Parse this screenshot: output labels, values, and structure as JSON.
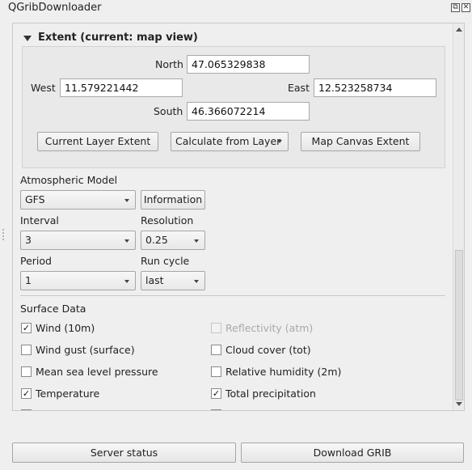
{
  "window": {
    "title": "QGribDownloader",
    "float_glyph": "⧉",
    "close_glyph": "✕"
  },
  "extent": {
    "title": "Extent (current: map view)",
    "north_label": "North",
    "north_value": "47.065329838",
    "west_label": "West",
    "west_value": "11.579221442",
    "east_label": "East",
    "east_value": "12.523258734",
    "south_label": "South",
    "south_value": "46.366072214",
    "current_layer_button": "Current Layer Extent",
    "calc_from_layer_button": "Calculate from Layer",
    "map_canvas_button": "Map Canvas Extent"
  },
  "model": {
    "label": "Atmospheric Model",
    "value": "GFS",
    "information_button": "Information"
  },
  "interval": {
    "label": "Interval",
    "value": "3"
  },
  "resolution": {
    "label": "Resolution",
    "value": "0.25"
  },
  "period": {
    "label": "Period",
    "value": "1"
  },
  "run_cycle": {
    "label": "Run cycle",
    "value": "last"
  },
  "surface": {
    "title": "Surface Data",
    "items": [
      {
        "label": "Wind (10m)",
        "checked": true,
        "enabled": true
      },
      {
        "label": "Reflectivity (atm)",
        "checked": false,
        "enabled": false
      },
      {
        "label": "Wind gust (surface)",
        "checked": false,
        "enabled": true
      },
      {
        "label": "Cloud cover (tot)",
        "checked": false,
        "enabled": true
      },
      {
        "label": "Mean sea level pressure",
        "checked": false,
        "enabled": true
      },
      {
        "label": "Relative humidity (2m)",
        "checked": false,
        "enabled": true
      },
      {
        "label": "Temperature",
        "checked": true,
        "enabled": true
      },
      {
        "label": "Total precipitation",
        "checked": true,
        "enabled": true
      }
    ]
  },
  "footer": {
    "server_status_button": "Server status",
    "download_button": "Download GRIB"
  }
}
